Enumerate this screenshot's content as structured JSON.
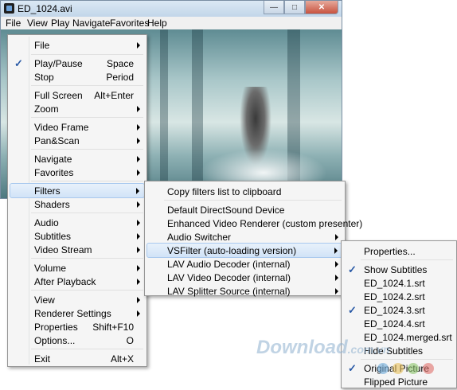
{
  "window": {
    "title": "ED_1024.avi",
    "menubar": [
      "File",
      "View",
      "Play",
      "Navigate",
      "Favorites",
      "Help"
    ]
  },
  "menu_main": [
    {
      "label": "File",
      "shortcut": "",
      "submenu": true
    },
    {
      "label": "Play/Pause",
      "shortcut": "Space",
      "checked": true
    },
    {
      "label": "Stop",
      "shortcut": "Period"
    },
    {
      "label": "Full Screen",
      "shortcut": "Alt+Enter"
    },
    {
      "label": "Zoom",
      "shortcut": "",
      "submenu": true
    },
    {
      "label": "Video Frame",
      "shortcut": "",
      "submenu": true
    },
    {
      "label": "Pan&Scan",
      "shortcut": "",
      "submenu": true
    },
    {
      "label": "Navigate",
      "shortcut": "",
      "submenu": true
    },
    {
      "label": "Favorites",
      "shortcut": "",
      "submenu": true
    },
    {
      "label": "Filters",
      "shortcut": "",
      "submenu": true,
      "highlighted": true
    },
    {
      "label": "Shaders",
      "shortcut": "",
      "submenu": true
    },
    {
      "label": "Audio",
      "shortcut": "",
      "submenu": true
    },
    {
      "label": "Subtitles",
      "shortcut": "",
      "submenu": true
    },
    {
      "label": "Video Stream",
      "shortcut": "",
      "submenu": true
    },
    {
      "label": "Volume",
      "shortcut": "",
      "submenu": true
    },
    {
      "label": "After Playback",
      "shortcut": "",
      "submenu": true
    },
    {
      "label": "View",
      "shortcut": "",
      "submenu": true
    },
    {
      "label": "Renderer Settings",
      "shortcut": "",
      "submenu": true
    },
    {
      "label": "Properties",
      "shortcut": "Shift+F10"
    },
    {
      "label": "Options...",
      "shortcut": "O"
    },
    {
      "label": "Exit",
      "shortcut": "Alt+X"
    }
  ],
  "menu_filters": [
    {
      "label": "Copy filters list to clipboard"
    },
    {
      "label": "Default DirectSound Device"
    },
    {
      "label": "Enhanced Video Renderer (custom presenter)"
    },
    {
      "label": "Audio Switcher",
      "submenu": true
    },
    {
      "label": "VSFilter (auto-loading version)",
      "submenu": true,
      "highlighted": true
    },
    {
      "label": "LAV Audio Decoder (internal)",
      "submenu": true
    },
    {
      "label": "LAV Video Decoder (internal)",
      "submenu": true
    },
    {
      "label": "LAV Splitter Source (internal)",
      "submenu": true
    }
  ],
  "menu_vsfilter": [
    {
      "label": "Properties..."
    },
    {
      "label": "Show Subtitles",
      "checked": true
    },
    {
      "label": "ED_1024.1.srt"
    },
    {
      "label": "ED_1024.2.srt"
    },
    {
      "label": "ED_1024.3.srt",
      "checked": true
    },
    {
      "label": "ED_1024.4.srt"
    },
    {
      "label": "ED_1024.merged.srt"
    },
    {
      "label": "Hide Subtitles"
    },
    {
      "label": "Original Picture",
      "checked": true
    },
    {
      "label": "Flipped Picture"
    }
  ],
  "watermark": {
    "text": "Download",
    "suffix": ".com.vn"
  },
  "colors": {
    "check": "#2a5aa6",
    "highlight": "#d1e3f7",
    "dots": [
      "#6aa9d8",
      "#e8c05a",
      "#8cc46a",
      "#e0706a"
    ]
  }
}
